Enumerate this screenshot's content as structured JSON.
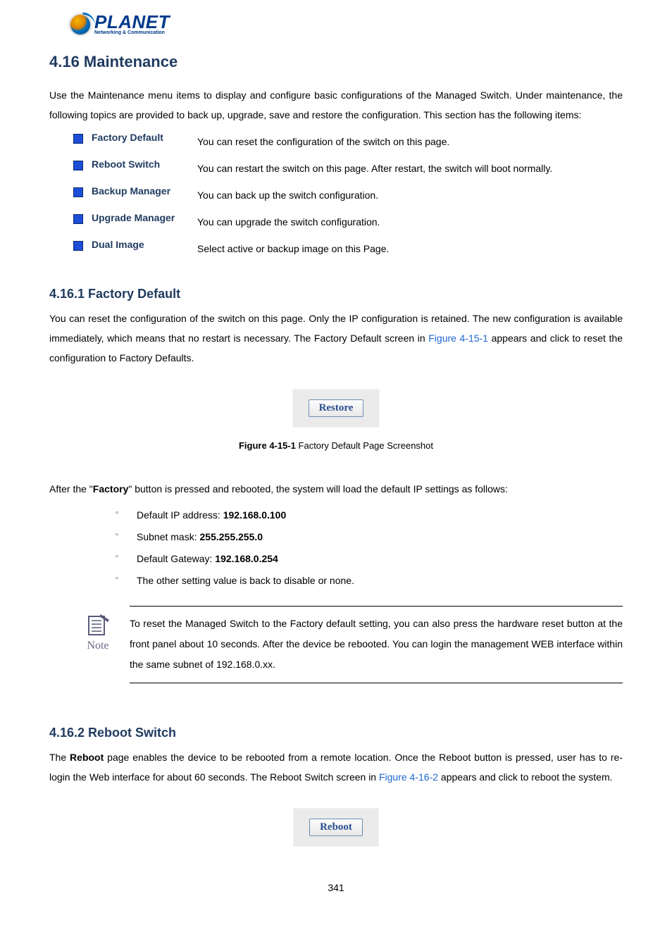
{
  "logo": {
    "brand": "PLANET",
    "tagline": "Networking & Communication"
  },
  "section_title": "4.16 Maintenance",
  "intro": "Use the Maintenance menu items to display and configure basic configurations of the Managed Switch. Under maintenance, the following topics are provided to back up, upgrade, save and restore the configuration. This section has the following items:",
  "menu": [
    {
      "label": "Factory Default",
      "desc": "You can reset the configuration of the switch on this page."
    },
    {
      "label": "Reboot Switch",
      "desc": "You can restart the switch on this page. After restart, the switch will boot normally."
    },
    {
      "label": "Backup Manager",
      "desc": "You can back up the switch configuration."
    },
    {
      "label": "Upgrade Manager",
      "desc": "You can upgrade the switch configuration."
    },
    {
      "label": "Dual Image",
      "desc": "Select active or backup image on this Page."
    }
  ],
  "sub1": {
    "title": "4.16.1 Factory Default",
    "para_a": "You can reset the configuration of the switch on this page. Only the IP configuration is retained. The new configuration is available immediately, which means that no restart is necessary. The Factory Default screen in ",
    "figref": "Figure 4-15-1",
    "para_b": " appears and click to reset the configuration to Factory Defaults.",
    "button": "Restore",
    "caption_bold": "Figure 4-15-1",
    "caption_rest": " Factory Default Page Screenshot",
    "after_a": "After the \"",
    "after_bold": "Factory",
    "after_b": "\" button is pressed and rebooted, the system will load the default IP settings as follows:",
    "defaults": [
      {
        "label": "Default IP address: ",
        "value": "192.168.0.100"
      },
      {
        "label": "Subnet mask: ",
        "value": "255.255.255.0"
      },
      {
        "label": "Default Gateway: ",
        "value": "192.168.0.254"
      },
      {
        "label": "The other setting value is back to disable or none.",
        "value": ""
      }
    ],
    "note_label": "Note",
    "note_text": "To reset the Managed Switch to the Factory default setting, you can also press the hardware reset button at the front panel about 10 seconds. After the device be rebooted. You can login the management WEB interface within the same subnet of 192.168.0.xx."
  },
  "sub2": {
    "title": "4.16.2 Reboot Switch",
    "para_a1": "The ",
    "para_bold": "Reboot",
    "para_a2": " page enables the device to be rebooted from a remote location. Once the Reboot button is pressed, user has to re-login the Web interface for about 60 seconds. The Reboot Switch screen in ",
    "figref": "Figure 4-16-2",
    "para_b": " appears and click to reboot the system.",
    "button": "Reboot"
  },
  "page_number": "341"
}
